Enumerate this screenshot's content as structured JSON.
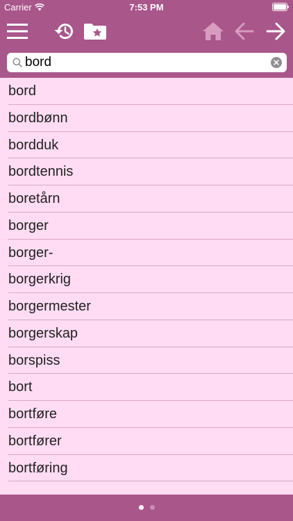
{
  "status_bar": {
    "carrier": "Carrier",
    "time": "7:53 PM"
  },
  "toolbar": {
    "icons": [
      "menu-icon",
      "history-icon",
      "favorites-folder-icon",
      "home-icon",
      "back-arrow-icon",
      "forward-arrow-icon"
    ],
    "colors": {
      "active": "#ffffff",
      "disabled": "#d79cc0"
    }
  },
  "search": {
    "query": "bord"
  },
  "words": [
    "bord",
    "bordbønn",
    "bordduk",
    "bordtennis",
    "boretårn",
    "borger",
    "borger-",
    "borgerkrig",
    "borgermester",
    "borgerskap",
    "borspiss",
    "bort",
    "bortføre",
    "bortfører",
    "bortføring"
  ],
  "pager": {
    "current_page": 1,
    "page_count": 2
  },
  "colors": {
    "header": "#a9568b",
    "list_background": "#ffdcf3",
    "separator": "#dba7c8",
    "text": "#222222"
  }
}
